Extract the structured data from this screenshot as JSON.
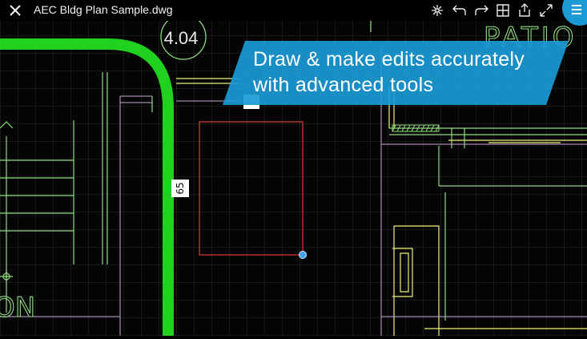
{
  "topbar": {
    "title": "AEC Bldg Plan Sample.dwg",
    "icons": [
      "close-icon",
      "snap-icon",
      "undo-icon",
      "redo-icon",
      "grid-icon",
      "share-icon",
      "fullscreen-icon",
      "menu-icon"
    ]
  },
  "drawing": {
    "room_label": "4.04",
    "area_label": "PATIO",
    "dimension_vertical": "65",
    "dimension_horizontal": "50",
    "partial_label": "ON"
  },
  "banner": {
    "line1": "Draw & make edits accurately",
    "line2": "with advanced tools"
  },
  "colors": {
    "background": "#050505",
    "grid": "#2a2a2a",
    "wall": "#21d11f",
    "lines_yellow": "#f0f078",
    "lines_green": "#8fdc7f",
    "lines_pink": "#c9a6d6",
    "selection_red": "#d23a2a",
    "banner": "#1b9ad6",
    "handle": "#3fa1ef"
  }
}
